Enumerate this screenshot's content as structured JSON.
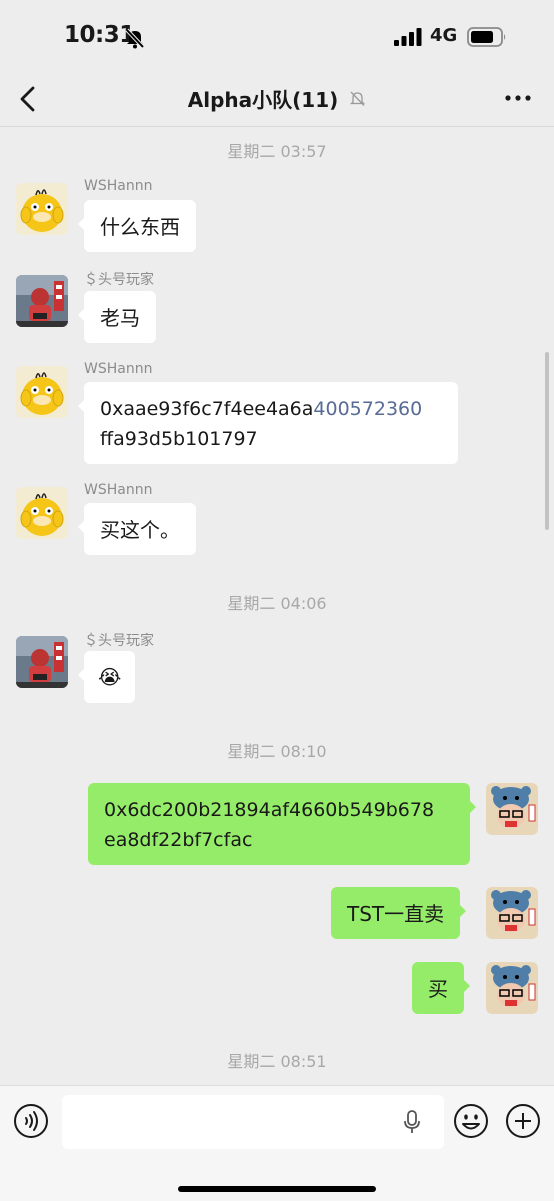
{
  "status": {
    "time": "10:31",
    "network": "4G"
  },
  "header": {
    "title": "Alpha小队(11)"
  },
  "messages": [
    {
      "kind": "time",
      "text": "星期二 03:57"
    },
    {
      "kind": "in",
      "sender": "WSHannn",
      "text": "什么东西",
      "avatar": "psyduck-avatar"
    },
    {
      "kind": "in",
      "sender": "＄头号玩家",
      "text": "老马",
      "avatar": "racer-avatar"
    },
    {
      "kind": "in",
      "sender": "WSHannn",
      "text_a": "0xaae93f6c7f4ee4a6a",
      "text_link": "400572360",
      "text_b": "ffa93d5b101797",
      "avatar": "psyduck-avatar"
    },
    {
      "kind": "in",
      "sender": "WSHannn",
      "text": "买这个。",
      "avatar": "psyduck-avatar"
    },
    {
      "kind": "time",
      "text": "星期二 04:06"
    },
    {
      "kind": "in",
      "sender": "＄头号玩家",
      "text": "😭",
      "avatar": "racer-avatar"
    },
    {
      "kind": "time",
      "text": "星期二 08:10"
    },
    {
      "kind": "out",
      "text_a": "0x6dc200b21894af4660b549b678",
      "text_b": "ea8df22bf7cfac",
      "avatar": "cartoon-avatar"
    },
    {
      "kind": "out",
      "text": "TST一直卖",
      "avatar": "cartoon-avatar"
    },
    {
      "kind": "out",
      "text": "买",
      "avatar": "cartoon-avatar"
    },
    {
      "kind": "time",
      "text": "星期二 08:51"
    }
  ],
  "input": {
    "value": "",
    "placeholder": ""
  },
  "icons": [
    "back-icon",
    "mute-icon",
    "more-icon",
    "voice-icon",
    "mic-icon",
    "emoji-icon",
    "plus-icon"
  ],
  "colors": {
    "background": "#ededed",
    "bubble_in": "#ffffff",
    "bubble_out": "#95ec69",
    "link": "#576b95"
  }
}
